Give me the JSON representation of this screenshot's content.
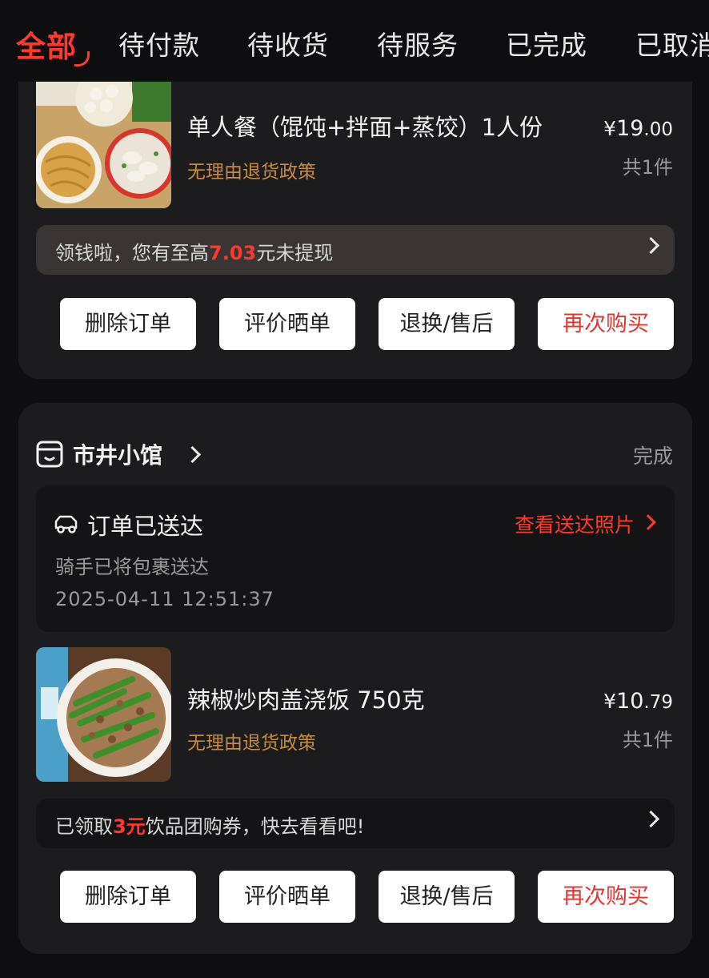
{
  "tabs": [
    "全部",
    "待付款",
    "待收货",
    "待服务",
    "已完成",
    "已取消"
  ],
  "order1": {
    "item_title": "单人餐（馄饨+拌面+蒸饺）1人份",
    "policy": "无理由退货政策",
    "price_yen": "¥",
    "price_int": "19",
    "price_dec": ".00",
    "qty": "共1件",
    "promo_prefix": "领钱啦，您有至高",
    "promo_amount": "7.03",
    "promo_suffix": "元未提现",
    "buttons": [
      "删除订单",
      "评价晒单",
      "退换/售后",
      "再次购买"
    ]
  },
  "order2": {
    "shop_name": "市井小馆",
    "status": "完成",
    "delivery_title": "订单已送达",
    "delivery_photo_link": "查看送达照片",
    "delivery_sub": "骑手已将包裹送达",
    "delivery_time": "2025-04-11 12:51:37",
    "item_title": "辣椒炒肉盖浇饭 750克",
    "policy": "无理由退货政策",
    "price_yen": "¥",
    "price_int": "10",
    "price_dec": ".79",
    "qty": "共1件",
    "promo_prefix": "已领取",
    "promo_amount": "3元",
    "promo_suffix": "饮品团购券，快去看看吧!",
    "buttons": [
      "删除订单",
      "评价晒单",
      "退换/售后",
      "再次购买"
    ]
  },
  "colors": {
    "accent": "#ff3a2a",
    "policy": "#c98a3e",
    "card": "#1c1b1d",
    "background": "#0e0e10"
  },
  "icons": [
    "shop-icon",
    "delivery-car-icon",
    "chevron-right-icon"
  ]
}
